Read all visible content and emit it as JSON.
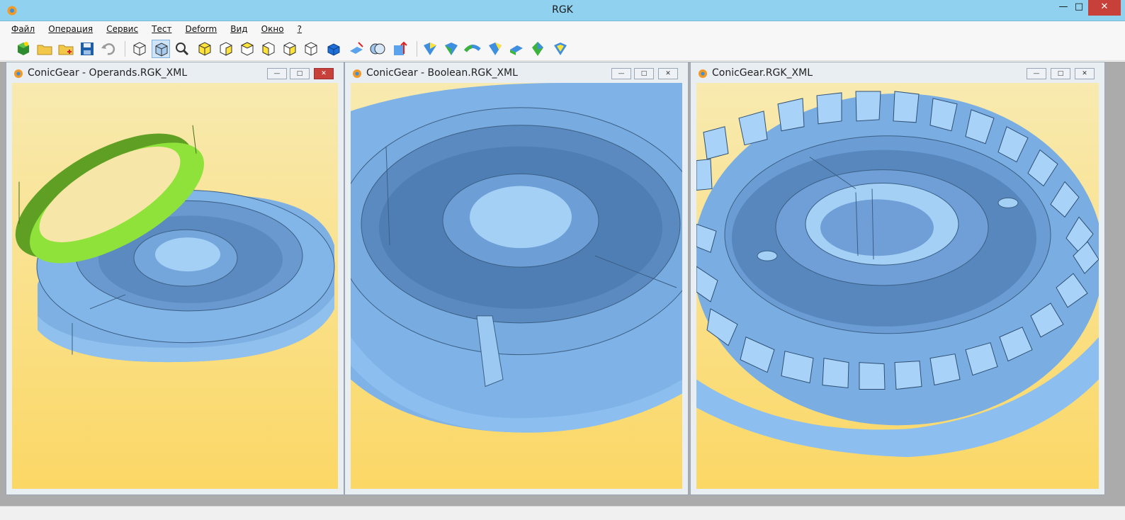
{
  "window": {
    "title": "RGK"
  },
  "menu": {
    "items": [
      {
        "label": "Файл",
        "name": "menu-file"
      },
      {
        "label": "Операция",
        "name": "menu-operation"
      },
      {
        "label": "Сервис",
        "name": "menu-service"
      },
      {
        "label": "Тест",
        "name": "menu-test"
      },
      {
        "label": "Deform",
        "name": "menu-deform"
      },
      {
        "label": "Вид",
        "name": "menu-view"
      },
      {
        "label": "Окно",
        "name": "menu-window"
      },
      {
        "label": "?",
        "name": "menu-help"
      }
    ]
  },
  "toolbar": {
    "icons": [
      "new-model-icon",
      "open-folder-icon",
      "new-folder-icon",
      "save-icon",
      "undo-icon",
      "wireframe-view-icon",
      "shaded-view-icon",
      "zoom-fit-icon",
      "view-front-icon",
      "view-back-icon",
      "view-top-icon",
      "view-bottom-icon",
      "view-left-icon",
      "view-right-icon",
      "view-iso-icon",
      "section-icon",
      "boolean-icon",
      "transform-icon",
      "fillet-icon",
      "extrude-icon",
      "sweep-icon",
      "loft-icon",
      "chamfer-icon",
      "shell-icon",
      "offset-icon"
    ],
    "active": "shaded-view-icon"
  },
  "windows": [
    {
      "title": "ConicGear - Operands.RGK_XML",
      "name": "child-window-operands"
    },
    {
      "title": "ConicGear - Boolean.RGK_XML",
      "name": "child-window-boolean"
    },
    {
      "title": "ConicGear.RGK_XML",
      "name": "child-window-result"
    }
  ],
  "colors": {
    "titlebar": "#8fd1ee",
    "part_blue": "#7fb2e6",
    "operand_green": "#6ec52a",
    "viewport_top": "#f8eab0",
    "viewport_bottom": "#fbd765"
  }
}
